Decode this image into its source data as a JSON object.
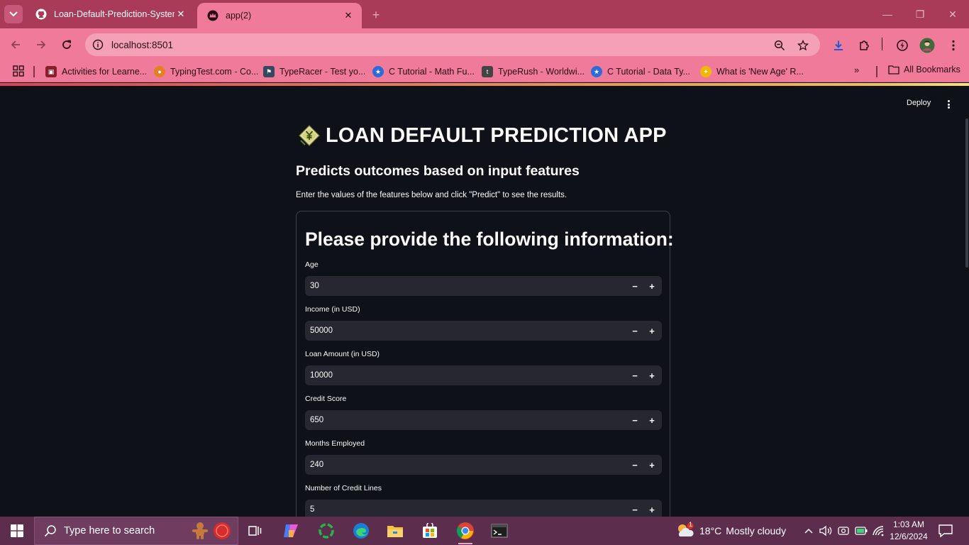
{
  "browser": {
    "tabs": [
      {
        "title": "Loan-Default-Prediction-System",
        "close": "✕"
      },
      {
        "title": "app(2)",
        "close": "✕"
      }
    ],
    "new_tab": "+",
    "window_controls": {
      "minimize": "—",
      "restore": "❐",
      "close": "✕"
    },
    "address": "localhost:8501",
    "bookmarks": [
      {
        "label": "Activities for Learne...",
        "icon": "crest-icon",
        "color": "#8b1e2d"
      },
      {
        "label": "TypingTest.com - Co...",
        "icon": "typingtest-icon",
        "color": "#e67e22"
      },
      {
        "label": "TypeRacer - Test yo...",
        "icon": "typeracer-icon",
        "color": "#34495e"
      },
      {
        "label": "C Tutorial - Math Fu...",
        "icon": "star-badge-icon",
        "color": "#2e6bd8"
      },
      {
        "label": "TypeRush - Worldwi...",
        "icon": "typerush-icon",
        "color": "#444444"
      },
      {
        "label": "C Tutorial - Data Ty...",
        "icon": "star-badge-icon",
        "color": "#2e6bd8"
      },
      {
        "label": "What is 'New Age' R...",
        "icon": "accessibility-icon",
        "color": "#f2b705"
      }
    ],
    "bookmarks_more": "»",
    "all_bookmarks": "All Bookmarks"
  },
  "app": {
    "deploy": "Deploy",
    "title": "LOAN DEFAULT PREDICTION APP",
    "subtitle": "Predicts outcomes based on input features",
    "instructions": "Enter the values of the features below and click \"Predict\" to see the results.",
    "form_heading": "Please provide the following information:",
    "fields": [
      {
        "label": "Age",
        "value": "30"
      },
      {
        "label": "Income (in USD)",
        "value": "50000"
      },
      {
        "label": "Loan Amount (in USD)",
        "value": "10000"
      },
      {
        "label": "Credit Score",
        "value": "650"
      },
      {
        "label": "Months Employed",
        "value": "240"
      },
      {
        "label": "Number of Credit Lines",
        "value": "5"
      }
    ],
    "stepper": {
      "minus": "−",
      "plus": "+"
    }
  },
  "taskbar": {
    "search_placeholder": "Type here to search",
    "weather": {
      "temp": "18°C",
      "condition": "Mostly cloudy",
      "alert_count": "1"
    },
    "time": "1:03 AM",
    "date": "12/6/2024"
  },
  "colors": {
    "page_bg": "#0e1117",
    "input_bg": "#262730",
    "tabbar": "#a93a58",
    "toolbar": "#f07a9a",
    "taskbar": "#5c2d4d"
  }
}
